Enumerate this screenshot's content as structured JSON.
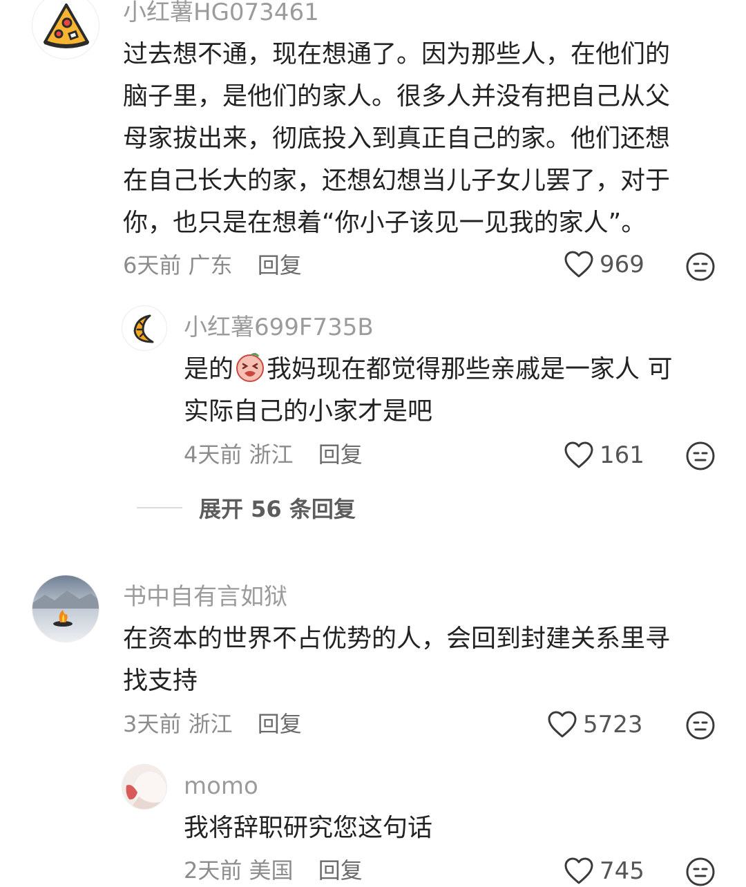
{
  "comments": [
    {
      "author": "小红薯HG073461",
      "avatar_icon": "pizza-icon",
      "lines": [
        "过去想不通，现在想通了。因为那些人，在他们的",
        "脑子里，是他们的家人。很多人并没有把自己从父",
        "母家拔出来，彻底投入到真正自己的家。他们还想",
        "在自己长大的家，还想幻想当儿子女儿罢了，对于",
        "你，也只是在想着“你小子该见一见我的家人”。"
      ],
      "time": "6天前",
      "location": "广东",
      "reply_label": "回复",
      "likes": "969",
      "replies": [
        {
          "author": "小红薯699F735B",
          "avatar_icon": "croissant-icon",
          "line1_before": "是的",
          "line1_after": "我妈现在都觉得那些亲戚是一家人 可",
          "line2": "实际自己的小家才是吧",
          "emoji": "crying-face-emoji",
          "time": "4天前",
          "location": "浙江",
          "reply_label": "回复",
          "likes": "161"
        }
      ],
      "expand_label": "展开 56 条回复"
    },
    {
      "author": "书中自有言如狱",
      "avatar_icon": "landscape-fire-avatar",
      "lines": [
        "在资本的世界不占优势的人，会回到封建关系里寻",
        "找支持"
      ],
      "time": "3天前",
      "location": "浙江",
      "reply_label": "回复",
      "likes": "5723",
      "replies": [
        {
          "author": "momo",
          "avatar_icon": "photo-avatar",
          "line1": "我将辞职研究您这句话",
          "time": "2天前",
          "location": "美国",
          "reply_label": "回复",
          "likes": "745"
        }
      ]
    }
  ],
  "colors": {
    "author": "#9b9b9b",
    "text": "#222222",
    "meta": "#8c8c8c"
  }
}
